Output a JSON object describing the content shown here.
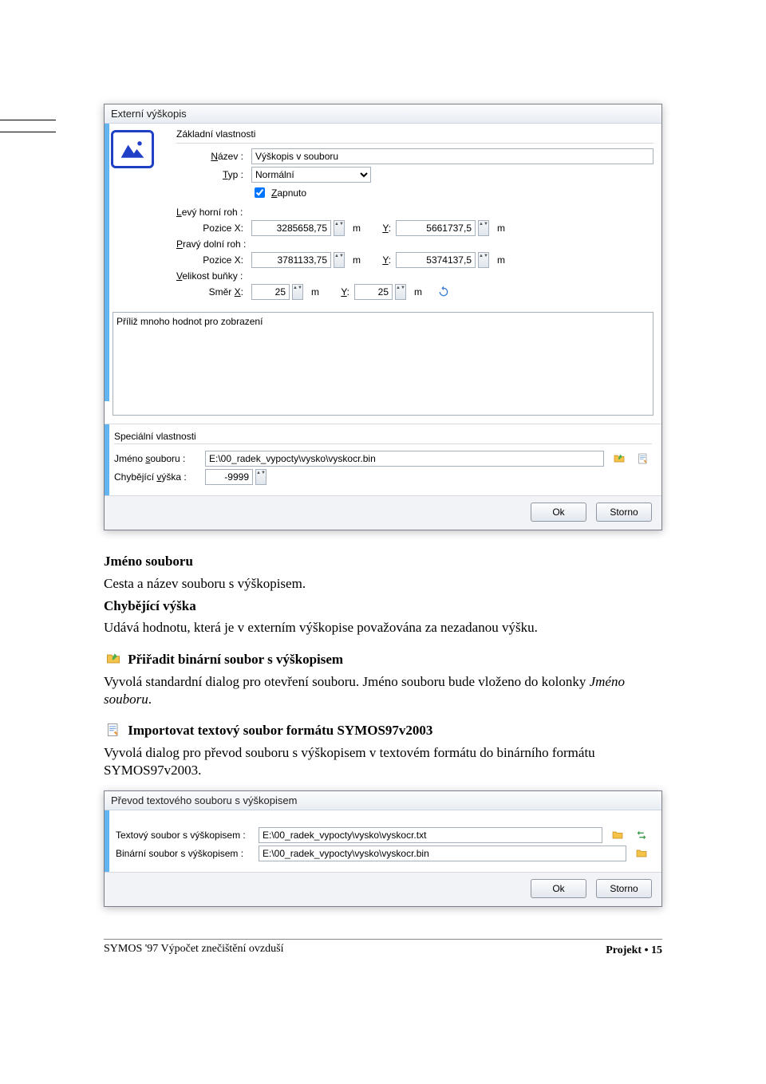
{
  "dialog1": {
    "title": "Externí výškopis",
    "section_basic": "Základní vlastnosti",
    "nazev_lbl": "Název :",
    "nazev_val": "Výškopis v souboru",
    "typ_lbl": "Typ :",
    "typ_val": "Normální",
    "zapnuto_lbl": "Zapnuto",
    "levy_lbl": "Levý horní roh :",
    "pravy_lbl": "Pravý dolní roh :",
    "pozice_x": "Pozice X:",
    "y_lbl": "Y:",
    "unit_m": "m",
    "lh_x": "3285658,75",
    "lh_y": "5661737,5",
    "pd_x": "3781133,75",
    "pd_y": "5374137,5",
    "velikost_lbl": "Velikost buňky :",
    "smer_x_lbl": "Směr X:",
    "smer_x_val": "25",
    "smer_y_val": "25",
    "grid_msg": "Příliž mnoho hodnot pro zobrazení",
    "section_special": "Speciální vlastnosti",
    "jmeno_lbl": "Jméno souboru :",
    "jmeno_val": "E:\\00_radek_vypocty\\vysko\\vyskocr.bin",
    "chyb_lbl": "Chybějící výška :",
    "chyb_val": "-9999",
    "ok": "Ok",
    "storno": "Storno"
  },
  "body": {
    "h1": "Jméno souboru",
    "p1": "Cesta a název souboru s výškopisem.",
    "h2": "Chybějící výška",
    "p2": "Udává hodnotu, která je v externím výškopise považována za nezadanou výšku.",
    "h3": "Přiřadit binární soubor s výškopisem",
    "p3": "Vyvolá standardní dialog pro otevření souboru. Jméno souboru bude vloženo do kolonky ",
    "p3_em": "Jméno souboru",
    "h4": "Importovat textový soubor formátu SYMOS97v2003",
    "p4": "Vyvolá dialog pro převod souboru s výškopisem v textovém formátu do binárního formátu SYMOS97v2003."
  },
  "dialog2": {
    "title": "Převod textového souboru s výškopisem",
    "txt_lbl": "Textový soubor s výškopisem :",
    "txt_val": "E:\\00_radek_vypocty\\vysko\\vyskocr.txt",
    "bin_lbl": "Binární soubor s výškopisem :",
    "bin_val": "E:\\00_radek_vypocty\\vysko\\vyskocr.bin",
    "ok": "Ok",
    "storno": "Storno"
  },
  "footer": {
    "left": "SYMOS '97 Výpočet znečištění ovzduší",
    "right_a": "Projekt",
    "right_b": "15"
  }
}
